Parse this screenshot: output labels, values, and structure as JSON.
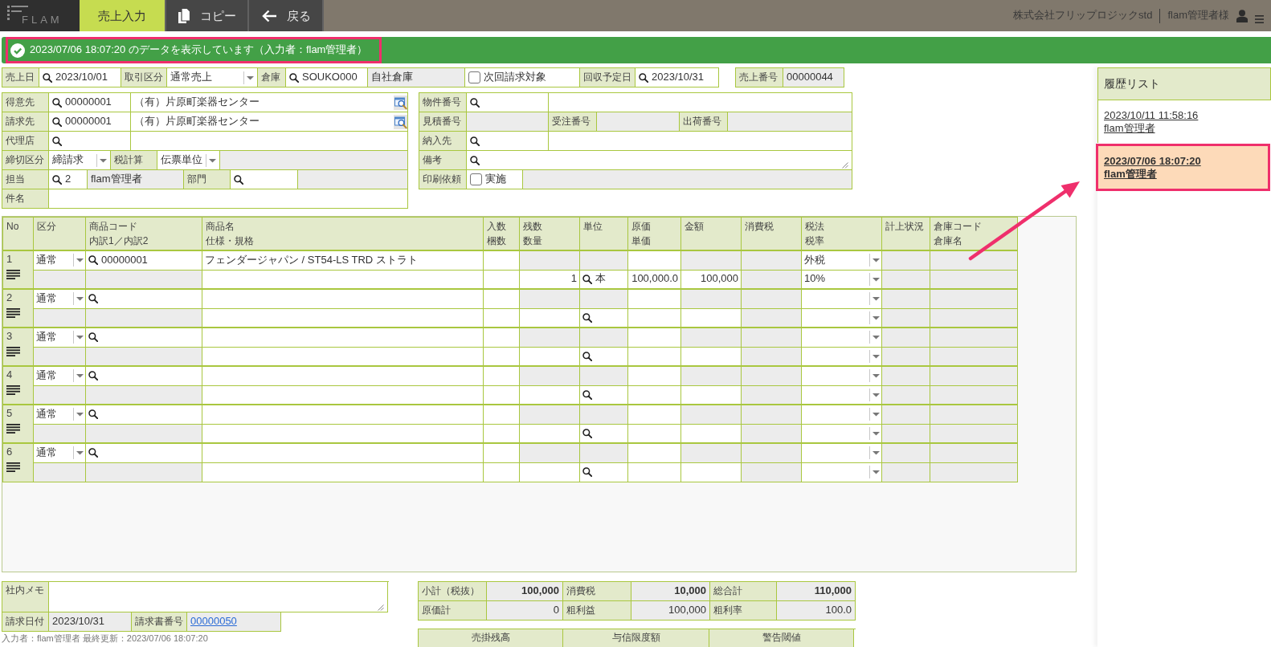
{
  "topbar": {
    "logo": "FLAM",
    "tabs": [
      {
        "kind": "page",
        "label": "売上入力",
        "selected": true
      },
      {
        "kind": "copy",
        "label": "コピー",
        "selected": false
      },
      {
        "kind": "back",
        "label": "戻る",
        "selected": false
      }
    ],
    "company": "株式会社フリップロジックstd",
    "user": "flam管理者様"
  },
  "banner": {
    "text": "2023/07/06 18:07:20 のデータを表示しています（入力者：flam管理者）",
    "highlighted": true
  },
  "header": {
    "fields": [
      {
        "kind": "label",
        "text": "売上日"
      },
      {
        "kind": "search",
        "value": "2023/10/01"
      },
      {
        "kind": "label",
        "text": "取引区分"
      },
      {
        "kind": "select",
        "value": "通常売上"
      },
      {
        "kind": "label",
        "text": "倉庫"
      },
      {
        "kind": "search",
        "value": "SOUKO000"
      },
      {
        "kind": "readonly",
        "value": "自社倉庫"
      },
      {
        "kind": "checkbox",
        "text": "次回請求対象",
        "checked": false
      },
      {
        "kind": "label",
        "text": "回収予定日"
      },
      {
        "kind": "search",
        "value": "2023/10/31"
      }
    ],
    "sales_number": [
      {
        "kind": "label",
        "text": "売上番号"
      },
      {
        "kind": "readonly",
        "value": "00000044"
      }
    ]
  },
  "customer_block": [
    [
      {
        "kind": "label",
        "text": "得意先"
      },
      {
        "kind": "search",
        "value": "00000001"
      },
      {
        "kind": "lookup",
        "value": "（有）片原町楽器センター"
      }
    ],
    [
      {
        "kind": "label",
        "text": "請求先"
      },
      {
        "kind": "search",
        "value": "00000001"
      },
      {
        "kind": "lookup",
        "value": "（有）片原町楽器センター"
      }
    ],
    [
      {
        "kind": "label",
        "text": "代理店"
      },
      {
        "kind": "search"
      },
      {
        "kind": "text"
      }
    ],
    [
      {
        "kind": "label",
        "text": "締切区分"
      },
      {
        "kind": "select",
        "value": "締請求"
      },
      {
        "kind": "label",
        "text": "税計算"
      },
      {
        "kind": "select",
        "value": "伝票単位"
      },
      {
        "kind": "readonly"
      }
    ],
    [
      {
        "kind": "label",
        "text": "担当"
      },
      {
        "kind": "search",
        "value": "2"
      },
      {
        "kind": "readonly",
        "value": "flam管理者"
      },
      {
        "kind": "label",
        "text": "部門"
      },
      {
        "kind": "search"
      },
      {
        "kind": "readonly"
      }
    ],
    [
      {
        "kind": "label",
        "text": "件名"
      },
      {
        "kind": "text"
      }
    ]
  ],
  "project_block": [
    [
      {
        "kind": "label",
        "text": "物件番号"
      },
      {
        "kind": "search"
      },
      {
        "kind": "text"
      }
    ],
    [
      {
        "kind": "label",
        "text": "見積番号"
      },
      {
        "kind": "readonly"
      },
      {
        "kind": "label",
        "text": "受注番号"
      },
      {
        "kind": "readonly"
      },
      {
        "kind": "label",
        "text": "出荷番号"
      },
      {
        "kind": "readonly"
      }
    ],
    [
      {
        "kind": "label",
        "text": "納入先"
      },
      {
        "kind": "search"
      },
      {
        "kind": "text"
      }
    ],
    [
      {
        "kind": "label",
        "text": "備考"
      },
      {
        "kind": "textarea",
        "search": true
      }
    ],
    [
      {
        "kind": "label",
        "text": "印刷依頼"
      },
      {
        "kind": "checkbox",
        "text": "実施",
        "checked": false
      },
      {
        "kind": "readonly"
      }
    ]
  ],
  "details": {
    "columns": [
      {
        "label": "No"
      },
      {
        "label": "区分"
      },
      {
        "label": "商品コード",
        "sublabel": "内訳1／内訳2"
      },
      {
        "label": "商品名",
        "sublabel": "仕様・規格"
      },
      {
        "label": "入数",
        "sublabel": "梱数"
      },
      {
        "label": "残数",
        "sublabel": "数量"
      },
      {
        "label": "単位"
      },
      {
        "label": "原価",
        "sublabel": "単価"
      },
      {
        "label": "金額"
      },
      {
        "label": "消費税"
      },
      {
        "label": "税法",
        "sublabel": "税率"
      },
      {
        "label": "計上状況"
      },
      {
        "label": "倉庫コード",
        "sublabel": "倉庫名"
      }
    ],
    "rows": [
      {
        "no": "1",
        "category": "通常",
        "code": "00000001",
        "product_name": "フェンダージャパン / ST54-LS TRD ストラト",
        "quantity": "1",
        "unit": "本",
        "unit_price": "100,000.0",
        "amount": "100,000",
        "tax_method": "外税",
        "tax_rate": "10%"
      },
      {
        "no": "2",
        "category": "通常"
      },
      {
        "no": "3",
        "category": "通常"
      },
      {
        "no": "4",
        "category": "通常"
      },
      {
        "no": "5",
        "category": "通常"
      },
      {
        "no": "6",
        "category": "通常"
      }
    ]
  },
  "memo": [
    {
      "kind": "label",
      "text": "社内メモ"
    },
    {
      "kind": "textarea",
      "search": false
    }
  ],
  "billing": [
    {
      "kind": "label",
      "text": "請求日付"
    },
    {
      "kind": "readonly",
      "value": "2023/10/31"
    },
    {
      "kind": "label",
      "text": "請求書番号"
    },
    {
      "kind": "link",
      "value": "00000050"
    }
  ],
  "footer_note": "入力者：flam管理者 最終更新：2023/07/06 18:07:20",
  "totals": [
    [
      {
        "kind": "label",
        "text": "小計（税抜）"
      },
      {
        "kind": "amount",
        "value": "100,000",
        "bold": true
      },
      {
        "kind": "label",
        "text": "消費税"
      },
      {
        "kind": "amount",
        "value": "10,000",
        "bold": true
      },
      {
        "kind": "label",
        "text": "総合計"
      },
      {
        "kind": "amount",
        "value": "110,000",
        "bold": true
      }
    ],
    [
      {
        "kind": "label",
        "text": "原価計"
      },
      {
        "kind": "amount",
        "value": "0",
        "bold": false
      },
      {
        "kind": "label",
        "text": "粗利益"
      },
      {
        "kind": "amount",
        "value": "100,000",
        "bold": false
      },
      {
        "kind": "label",
        "text": "粗利率"
      },
      {
        "kind": "amount",
        "value": "100.0",
        "bold": false
      }
    ]
  ],
  "credit": {
    "columns": [
      "売掛残高",
      "与信限度額",
      "警告閾値"
    ]
  },
  "history": {
    "title": "履歴リスト",
    "items": [
      {
        "time": "2023/10/11 11:58:16",
        "user": "flam管理者",
        "selected": false,
        "highlighted": false
      },
      {
        "time": "2023/07/06 18:07:20",
        "user": "flam管理者",
        "selected": true,
        "highlighted": true
      }
    ]
  },
  "annotation_arrow": true
}
